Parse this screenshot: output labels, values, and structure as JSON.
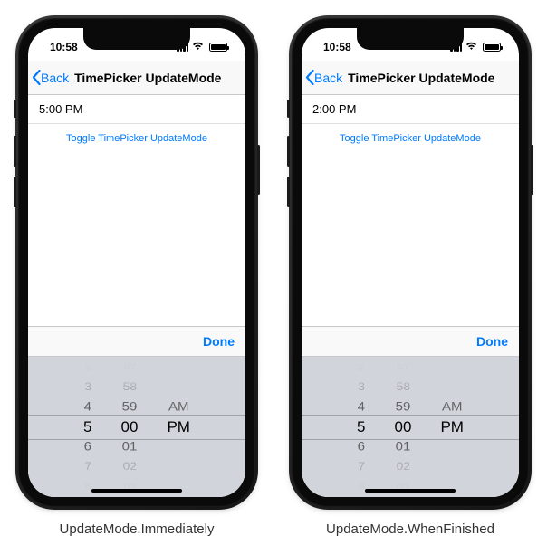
{
  "status": {
    "time": "10:58"
  },
  "nav": {
    "back": "Back",
    "title": "TimePicker UpdateMode"
  },
  "toggle": "Toggle TimePicker UpdateMode",
  "done": "Done",
  "phones": {
    "left": {
      "displayed_time": "5:00 PM",
      "caption": "UpdateMode.Immediately"
    },
    "right": {
      "displayed_time": "2:00 PM",
      "caption": "UpdateMode.WhenFinished"
    }
  },
  "picker": {
    "hour": {
      "rows": [
        "2",
        "3",
        "4",
        "5",
        "6",
        "7",
        "8"
      ],
      "selected_index": 3
    },
    "minute": {
      "rows": [
        "57",
        "58",
        "59",
        "00",
        "01",
        "02",
        "03"
      ],
      "selected_index": 3
    },
    "period": {
      "rows": [
        "AM",
        "PM"
      ],
      "selected_index": 1
    }
  }
}
